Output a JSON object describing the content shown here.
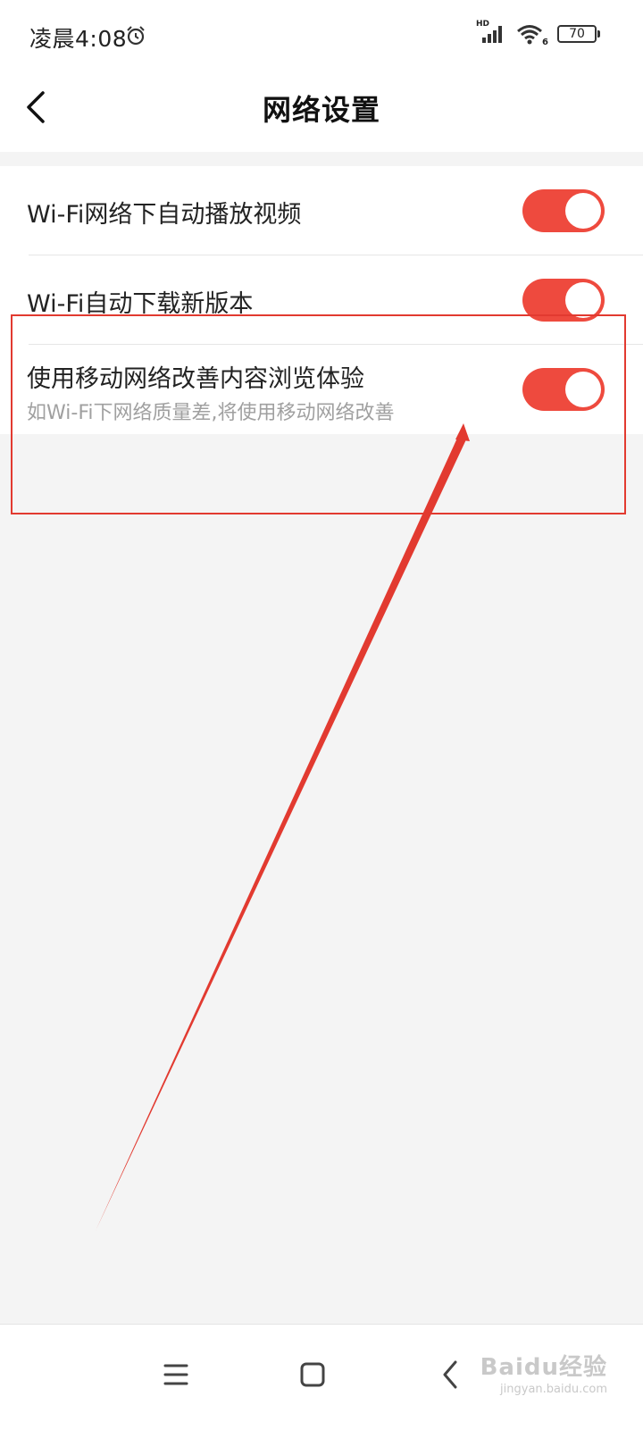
{
  "status_bar": {
    "time": "凌晨4:08",
    "signal_label": "HD",
    "wifi_label": "6",
    "battery": "70",
    "icons": [
      "alarm-icon",
      "signal-icon",
      "wifi-icon",
      "battery-icon"
    ]
  },
  "header": {
    "title": "网络设置",
    "back_icon": "chevron-left-icon"
  },
  "settings": [
    {
      "label": "Wi-Fi网络下自动播放视频",
      "description": "",
      "enabled": true
    },
    {
      "label": "Wi-Fi自动下载新版本",
      "description": "",
      "enabled": true
    },
    {
      "label": "使用移动网络改善内容浏览体验",
      "description": "如Wi-Fi下网络质量差,将使用移动网络改善",
      "enabled": true
    }
  ],
  "nav_bar": {
    "icons": [
      "menu-icon",
      "home-icon",
      "back-icon"
    ]
  },
  "watermark": {
    "text": "Baidu经验",
    "subtext": "jingyan.baidu.com"
  },
  "colors": {
    "toggle_on": "#ee4a3e",
    "annotation": "#e23a30",
    "background": "#f4f4f4"
  }
}
